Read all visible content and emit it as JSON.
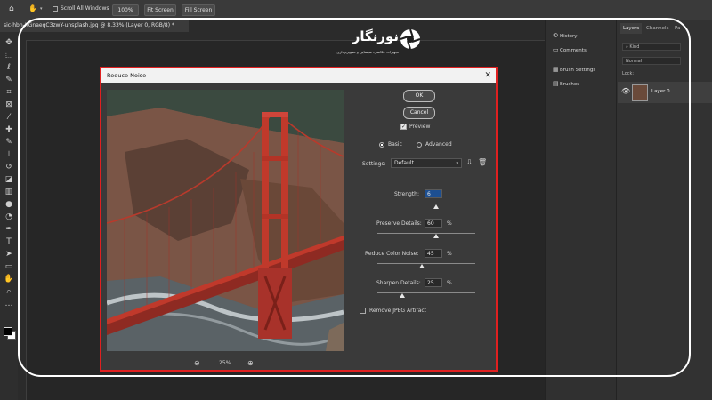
{
  "options_bar": {
    "scroll_all_windows": "Scroll All Windows",
    "zoom_value": "100%",
    "fit_screen": "Fit Screen",
    "fill_screen": "Fill Screen",
    "scroll_checked": false
  },
  "document_tab": {
    "title": "sic-hbn-KGnaeqC3zwY-unsplash.jpg @ 8.33% (Layer 0, RGB/8) *"
  },
  "tools": [
    "move-icon",
    "marquee-icon",
    "lasso-icon",
    "quick-select-icon",
    "crop-icon",
    "frame-icon",
    "eyedropper-icon",
    "healing-icon",
    "brush-icon",
    "stamp-icon",
    "history-brush-icon",
    "eraser-icon",
    "gradient-icon",
    "blur-icon",
    "dodge-icon",
    "pen-icon",
    "type-icon",
    "path-select-icon",
    "shape-icon",
    "hand-icon",
    "zoom-icon",
    "more-icon"
  ],
  "right_strip": {
    "items": [
      {
        "label": "History",
        "icon": "history-icon"
      },
      {
        "label": "Comments",
        "icon": "comments-icon"
      },
      {
        "label": "Brush Settings",
        "icon": "brush-settings-icon"
      },
      {
        "label": "Brushes",
        "icon": "brushes-icon"
      }
    ]
  },
  "layers_panel": {
    "tabs": [
      "Layers",
      "Channels",
      "Pa"
    ],
    "filter_label": "Kind",
    "blend_mode": "Normal",
    "lock_label": "Lock:",
    "layer_name": "Layer 0"
  },
  "dialog": {
    "title": "Reduce Noise",
    "ok_label": "OK",
    "cancel_label": "Cancel",
    "preview_label": "Preview",
    "preview_checked": true,
    "mode_basic": "Basic",
    "mode_advanced": "Advanced",
    "mode_selected": "Basic",
    "settings_label": "Settings:",
    "settings_value": "Default",
    "strength_label": "Strength:",
    "strength_value": "6",
    "preserve_label": "Preserve Details:",
    "preserve_value": "60",
    "color_noise_label": "Reduce Color Noise:",
    "color_noise_value": "45",
    "sharpen_label": "Sharpen Details:",
    "sharpen_value": "25",
    "percent": "%",
    "jpeg_label": "Remove JPEG Artifact",
    "jpeg_checked": false,
    "zoom_value": "25%",
    "slider_levels": {
      "strength": 0.6,
      "preserve": 0.6,
      "color_noise": 0.45,
      "sharpen": 0.25
    }
  },
  "watermark": {
    "brand": "نورنگار",
    "tagline": "تجهیزات عکاسی، سینمایی و تصویربرداری"
  },
  "colors": {
    "dialog_border": "#e02020",
    "bridge": "#c0392b",
    "frame": "#ffffff"
  }
}
